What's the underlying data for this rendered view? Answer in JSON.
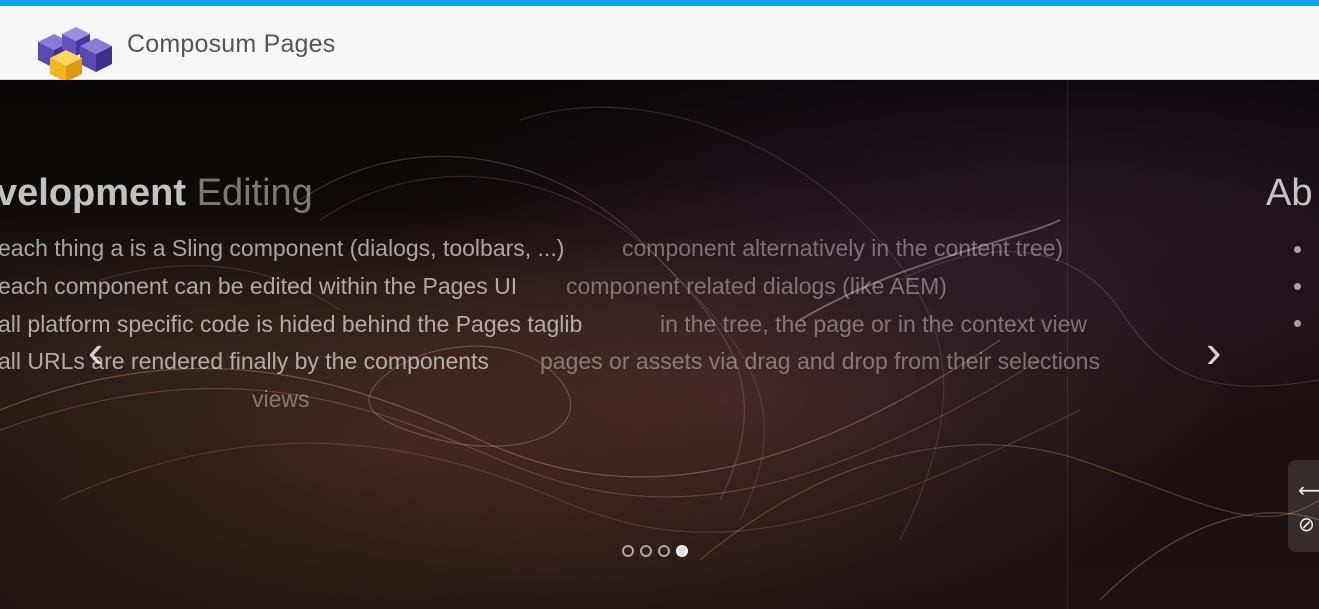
{
  "header": {
    "brand": "Composum Pages"
  },
  "slides": {
    "left_title_bold": "velopment",
    "left_title_light": "Editing",
    "right_title": "Ab",
    "lines": [
      "each thing a is a Sling component (dialogs, toolbars, ...)",
      "each component can be edited within the Pages UI",
      "all platform specific code is hided behind the Pages taglib",
      "all URLs are rendered finally by the components"
    ],
    "overlay_lines": [
      "component alternatively in the content tree)",
      "component related dialogs (like AEM)",
      "in the tree, the page or in the context view",
      "pages or assets via drag and drop from their selections"
    ],
    "overlay_continuation": "views"
  },
  "controls": {
    "prev_icon": "chevron-left-icon",
    "next_icon": "chevron-right-icon",
    "dots_count": 4,
    "active_dot": 4
  },
  "side_panel": {
    "icons": [
      "arrows-horizontal-icon",
      "eye-slash-icon"
    ]
  },
  "colors": {
    "accent": "#10a6e6",
    "header_bg": "#f7f7f7"
  }
}
